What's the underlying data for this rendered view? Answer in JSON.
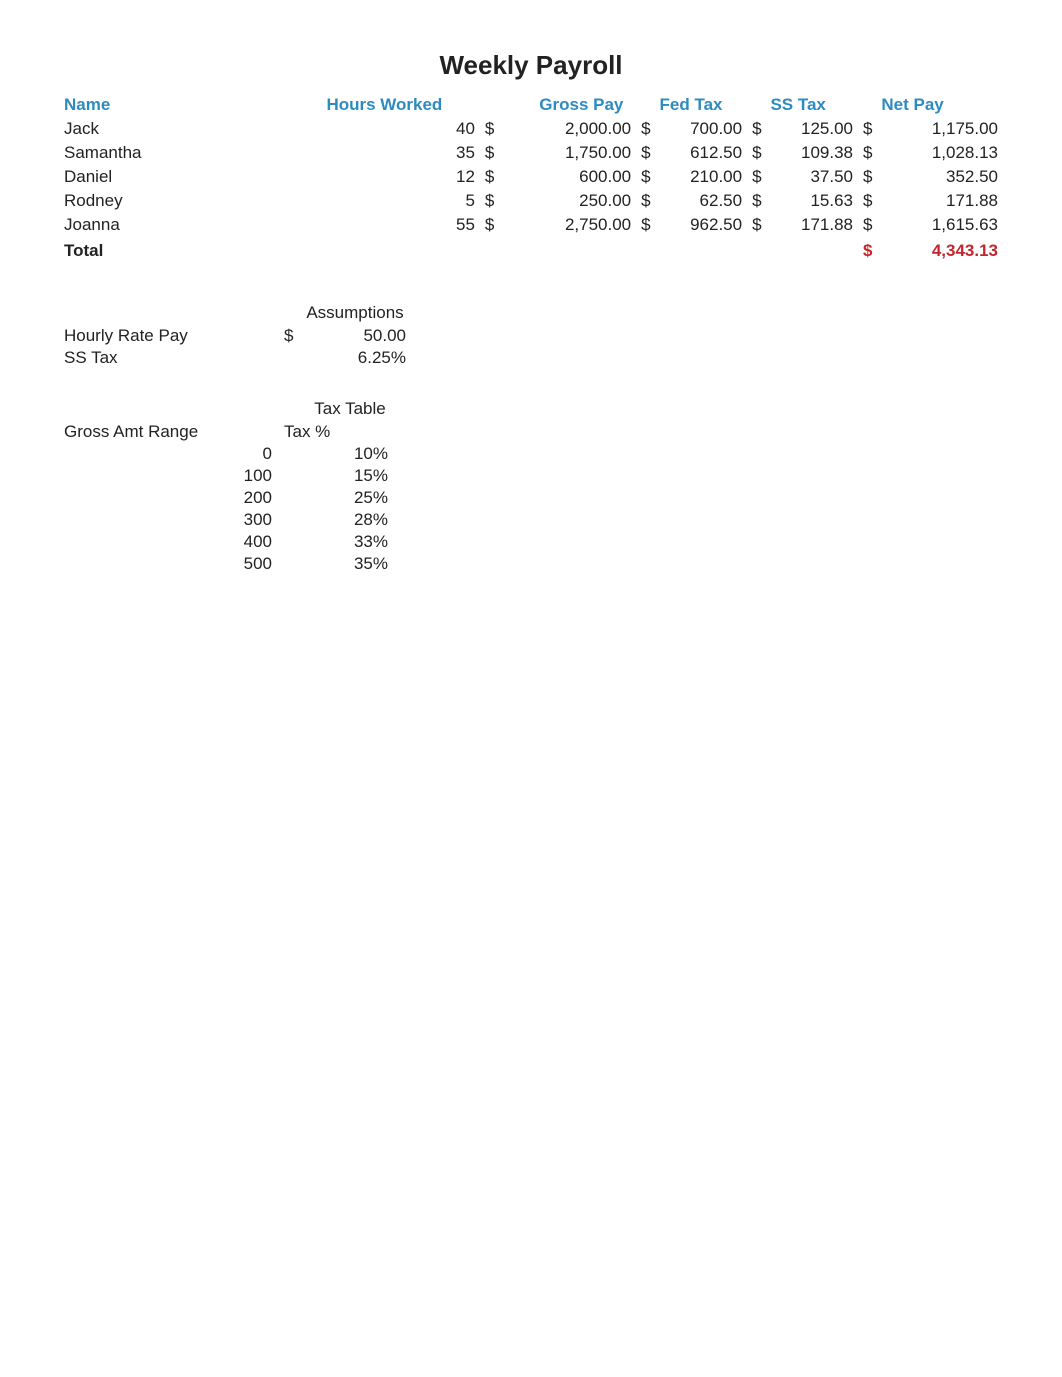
{
  "title": "Weekly Payroll",
  "headers": {
    "name": "Name",
    "hours": "Hours Worked",
    "gross": "Gross Pay",
    "fed": "Fed Tax",
    "ss": "SS Tax",
    "net": "Net Pay"
  },
  "rows": [
    {
      "name": "Jack",
      "hours": "40",
      "gross": "2,000.00",
      "fed": "700.00",
      "ss": "125.00",
      "net": "1,175.00"
    },
    {
      "name": "Samantha",
      "hours": "35",
      "gross": "1,750.00",
      "fed": "612.50",
      "ss": "109.38",
      "net": "1,028.13"
    },
    {
      "name": "Daniel",
      "hours": "12",
      "gross": "600.00",
      "fed": "210.00",
      "ss": "37.50",
      "net": "352.50"
    },
    {
      "name": "Rodney",
      "hours": "5",
      "gross": "250.00",
      "fed": "62.50",
      "ss": "15.63",
      "net": "171.88"
    },
    {
      "name": "Joanna",
      "hours": "55",
      "gross": "2,750.00",
      "fed": "962.50",
      "ss": "171.88",
      "net": "1,615.63"
    }
  ],
  "total": {
    "label": "Total",
    "amount": "4,343.13"
  },
  "currency": "$",
  "assumptions": {
    "header": "Assumptions",
    "items": [
      {
        "label": "Hourly Rate Pay",
        "currency": "$",
        "value": "50.00"
      },
      {
        "label": "SS Tax",
        "currency": "",
        "value": "6.25%"
      }
    ]
  },
  "tax_table": {
    "header": "Tax Table",
    "range_label": "Gross Amt Range",
    "pct_label": "Tax %",
    "rows": [
      {
        "range": "0",
        "pct": "10%"
      },
      {
        "range": "100",
        "pct": "15%"
      },
      {
        "range": "200",
        "pct": "25%"
      },
      {
        "range": "300",
        "pct": "28%"
      },
      {
        "range": "400",
        "pct": "33%"
      },
      {
        "range": "500",
        "pct": "35%"
      }
    ]
  },
  "chart_data": {
    "type": "table",
    "title": "Weekly Payroll",
    "columns": [
      "Name",
      "Hours Worked",
      "Gross Pay",
      "Fed Tax",
      "SS Tax",
      "Net Pay"
    ],
    "rows": [
      [
        "Jack",
        40,
        2000.0,
        700.0,
        125.0,
        1175.0
      ],
      [
        "Samantha",
        35,
        1750.0,
        612.5,
        109.38,
        1028.13
      ],
      [
        "Daniel",
        12,
        600.0,
        210.0,
        37.5,
        352.5
      ],
      [
        "Rodney",
        5,
        250.0,
        62.5,
        15.63,
        171.88
      ],
      [
        "Joanna",
        55,
        2750.0,
        962.5,
        171.88,
        1615.63
      ]
    ],
    "total_net_pay": 4343.13,
    "assumptions": {
      "hourly_rate_pay": 50.0,
      "ss_tax_rate": 0.0625
    },
    "tax_table": [
      {
        "gross_amt_range": 0,
        "tax_pct": 0.1
      },
      {
        "gross_amt_range": 100,
        "tax_pct": 0.15
      },
      {
        "gross_amt_range": 200,
        "tax_pct": 0.25
      },
      {
        "gross_amt_range": 300,
        "tax_pct": 0.28
      },
      {
        "gross_amt_range": 400,
        "tax_pct": 0.33
      },
      {
        "gross_amt_range": 500,
        "tax_pct": 0.35
      }
    ]
  }
}
